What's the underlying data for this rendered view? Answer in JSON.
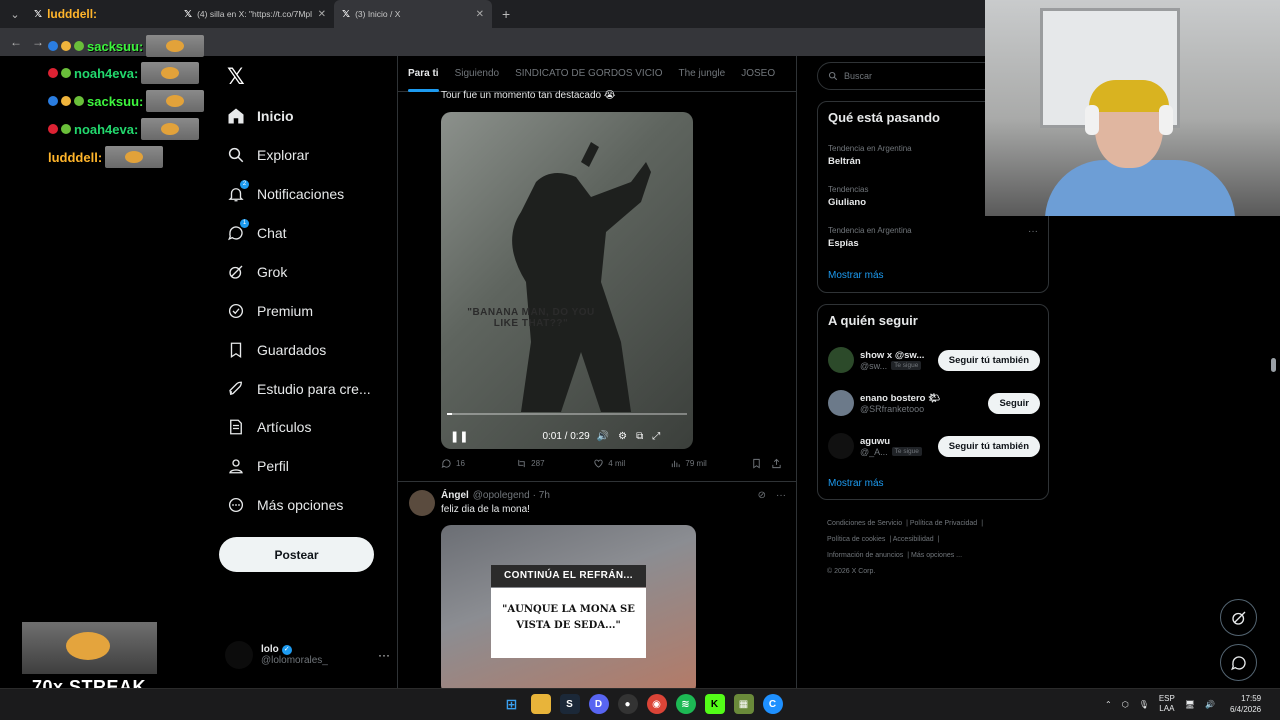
{
  "browser": {
    "tabs": [
      {
        "label": "ludddell:",
        "active": false
      },
      {
        "label": "(4) silla en X: \"https://t.co/7Mpl",
        "active": false
      },
      {
        "label": "(3) Inicio / X",
        "active": true
      }
    ]
  },
  "overlay_chat": [
    {
      "name": "sacksuu:",
      "color": "#3df53d",
      "top": 0
    },
    {
      "name": "noah4eva:",
      "color": "#22d86d",
      "top": 0
    },
    {
      "name": "sacksuu:",
      "color": "#3df53d",
      "top": 0
    },
    {
      "name": "noah4eva:",
      "color": "#22d86d",
      "top": 0
    },
    {
      "name": "ludddell:",
      "color": "#ffb52b",
      "top": 0
    }
  ],
  "sidebar": {
    "items": [
      {
        "label": "Inicio",
        "icon": "home-icon"
      },
      {
        "label": "Explorar",
        "icon": "search-icon"
      },
      {
        "label": "Notificaciones",
        "icon": "bell-icon",
        "badge": "2"
      },
      {
        "label": "Chat",
        "icon": "chat-icon",
        "badge": "1"
      },
      {
        "label": "Grok",
        "icon": "grok-icon"
      },
      {
        "label": "Premium",
        "icon": "premium-icon"
      },
      {
        "label": "Guardados",
        "icon": "bookmark-icon"
      },
      {
        "label": "Estudio para cre...",
        "icon": "rocket-icon"
      },
      {
        "label": "Artículos",
        "icon": "article-icon"
      },
      {
        "label": "Perfil",
        "icon": "user-icon"
      },
      {
        "label": "Más opciones",
        "icon": "more-circle-icon"
      }
    ],
    "post_label": "Postear",
    "profile": {
      "name": "lolo",
      "handle": "@lolomorales_"
    }
  },
  "timeline": {
    "tabs": [
      "Para ti",
      "Siguiendo",
      "SINDICATO DE GORDOS VICIO",
      "The jungle",
      "JOSEO"
    ],
    "tweet1": {
      "text_tail": "Tour fue un momento tan destacado 😭",
      "video_caption": "\"BANANA MAN, DO YOU LIKE THAT??\"",
      "video_time": "0:01 / 0:29",
      "progress": 0.02,
      "replies": "16",
      "reposts": "287",
      "likes": "4 mil",
      "views": "79 mil"
    },
    "tweet2": {
      "name": "Ángel",
      "handle": "@opolegend",
      "time": "· 7h",
      "text": "feliz dia de la mona!",
      "media_title": "CONTINÚA EL REFRÁN...",
      "media_quote": "\"AUNQUE LA MONA SE VISTA DE SEDA...\""
    }
  },
  "right": {
    "search_placeholder": "Buscar",
    "trends_title": "Qué está pasando",
    "trends": [
      {
        "context": "Tendencia en Argentina",
        "name": "Beltrán"
      },
      {
        "context": "Tendencias",
        "name": "Giuliano"
      },
      {
        "context": "Tendencia en Argentina",
        "name": "Espías"
      }
    ],
    "show_more": "Mostrar más",
    "follow_title": "A quién seguir",
    "follow": [
      {
        "name": "show x @sw...",
        "handle": "@sw...",
        "tag": "Te sigue",
        "button": "Seguir tú también"
      },
      {
        "name": "enano bostero 🌤",
        "handle": "@SRfranketooo",
        "tag": "",
        "button": "Seguir"
      },
      {
        "name": "aguwu",
        "handle": "@_A...",
        "tag": "Te sigue",
        "button": "Seguir tú también"
      }
    ],
    "footer": [
      "Condiciones de Servicio",
      "Política de Privacidad",
      "Política de cookies",
      "Accesibilidad",
      "Información de anuncios",
      "Más opciones ...",
      "© 2026 X Corp."
    ]
  },
  "streak": "70x STREAK",
  "taskbar": {
    "lang": "ESP",
    "lang2": "LAA",
    "time": "17:59",
    "date": "6/4/2026"
  },
  "colors": {
    "accent": "#1d9bf0",
    "bg": "#000000",
    "muted": "#71767b"
  }
}
